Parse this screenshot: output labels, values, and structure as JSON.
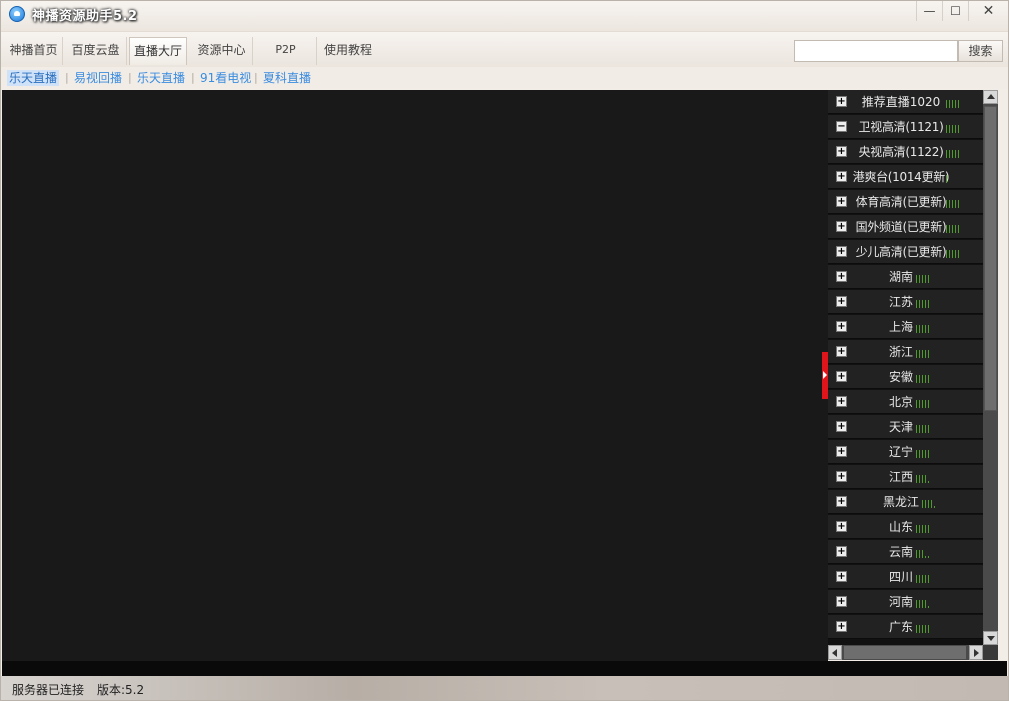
{
  "window": {
    "title": "神播资源助手5.2",
    "minimize_icon": "minimize-icon",
    "maximize_icon": "maximize-icon",
    "close_icon": "close-icon"
  },
  "toolbar": {
    "tabs": [
      {
        "label": "神播首页"
      },
      {
        "label": "百度云盘"
      },
      {
        "label": "直播大厅"
      },
      {
        "label": "资源中心"
      },
      {
        "label": "P2P"
      },
      {
        "label": "使用教程"
      }
    ],
    "active_tab": "直播大厅",
    "search": {
      "value": "",
      "placeholder": "",
      "button_label": "搜索"
    }
  },
  "subnav": {
    "links": [
      {
        "label": "乐天直播"
      },
      {
        "label": "易视回播"
      },
      {
        "label": "乐天直播"
      },
      {
        "label": "91看电视"
      },
      {
        "label": "夏科直播"
      }
    ],
    "separator": "|"
  },
  "channels": [
    {
      "label": "推荐直播1020",
      "toggle": "+",
      "signal": "full"
    },
    {
      "label": "卫视高清(1121)",
      "toggle": "−",
      "signal": "full"
    },
    {
      "label": "央视高清(1122)",
      "toggle": "+",
      "signal": "full"
    },
    {
      "label": "港爽台(1014更新)",
      "toggle": "+",
      "signal": "one"
    },
    {
      "label": "体育高清(已更新)",
      "toggle": "+",
      "signal": "full"
    },
    {
      "label": "国外频道(已更新)",
      "toggle": "+",
      "signal": "full"
    },
    {
      "label": "少儿高清(已更新)",
      "toggle": "+",
      "signal": "full"
    },
    {
      "label": "湖南",
      "toggle": "+",
      "signal": "full"
    },
    {
      "label": "江苏",
      "toggle": "+",
      "signal": "full"
    },
    {
      "label": "上海",
      "toggle": "+",
      "signal": "full"
    },
    {
      "label": "浙江",
      "toggle": "+",
      "signal": "full"
    },
    {
      "label": "安徽",
      "toggle": "+",
      "signal": "full"
    },
    {
      "label": "北京",
      "toggle": "+",
      "signal": "full"
    },
    {
      "label": "天津",
      "toggle": "+",
      "signal": "full"
    },
    {
      "label": "辽宁",
      "toggle": "+",
      "signal": "full"
    },
    {
      "label": "江西",
      "toggle": "+",
      "signal": "four"
    },
    {
      "label": "黑龙江",
      "toggle": "+",
      "signal": "four"
    },
    {
      "label": "山东",
      "toggle": "+",
      "signal": "full"
    },
    {
      "label": "云南",
      "toggle": "+",
      "signal": "three"
    },
    {
      "label": "四川",
      "toggle": "+",
      "signal": "full"
    },
    {
      "label": "河南",
      "toggle": "+",
      "signal": "four"
    },
    {
      "label": "广东",
      "toggle": "+",
      "signal": "full"
    }
  ],
  "status": {
    "connection": "服务器已连接",
    "version": "版本:5.2"
  },
  "colors": {
    "player_bg": "#191919",
    "channel_bg": "#222222",
    "signal": "#4f9a2d",
    "handle": "#e0141b",
    "link": "#3a8ce0"
  }
}
